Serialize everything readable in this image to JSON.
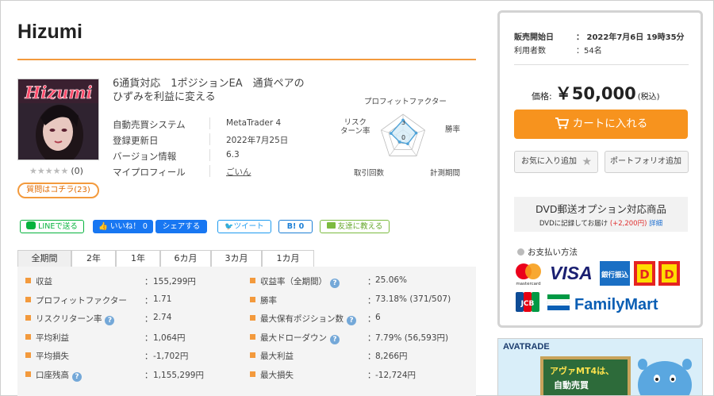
{
  "product": {
    "title": "Hizumi",
    "thumb_text": "Hizumi",
    "rating_stars": "★★★★★",
    "rating_count": "(0)",
    "qa_button": "質問はコチラ(23)",
    "description": "6通貨対応　1ポジションEA　通貨ペアの\nひずみを利益に変える"
  },
  "info": [
    {
      "label": "自動売買システム",
      "value": "MetaTrader 4"
    },
    {
      "label": "登録更新日",
      "value": "2022年7月25日"
    },
    {
      "label": "バージョン情報",
      "value": "6.3"
    },
    {
      "label": "マイプロフィール",
      "value": "ごいん"
    }
  ],
  "radar": {
    "labels": {
      "top": "プロフィットファクター",
      "right_top": "勝率",
      "right_bottom": "計測期間",
      "left_bottom": "取引回数",
      "left_top": "リスク\nターン率"
    },
    "scale_3": "3",
    "scale_0": "0",
    "values": [
      0.75,
      0.6,
      0.35,
      0.25,
      0.55
    ],
    "fill_color": "#d6ecf7",
    "stroke_color": "#4fa3d8"
  },
  "social": {
    "line": "LINEで送る",
    "like": "いいね！ 0",
    "share": "シェアする",
    "tweet": "ツイート",
    "hatena": "B! 0",
    "mail": "友達に教える"
  },
  "tabs": [
    "全期間",
    "2年",
    "1年",
    "6カ月",
    "3カ月",
    "1カ月"
  ],
  "stats_left": [
    {
      "label": "収益",
      "value": "155,299円",
      "help": false
    },
    {
      "label": "プロフィットファクター",
      "value": "1.71",
      "help": false
    },
    {
      "label": "リスクリターン率",
      "value": "2.74",
      "help": true
    },
    {
      "label": "平均利益",
      "value": "1,064円",
      "help": false
    },
    {
      "label": "平均損失",
      "value": "-1,702円",
      "help": false
    },
    {
      "label": "口座残高",
      "value": "1,155,299円",
      "help": true
    }
  ],
  "stats_right": [
    {
      "label": "収益率（全期間）",
      "value": "25.06%",
      "help": true
    },
    {
      "label": "勝率",
      "value": "73.18% (371/507)",
      "help": false
    },
    {
      "label": "最大保有ポジション数",
      "value": "6",
      "help": true
    },
    {
      "label": "最大ドローダウン",
      "value": "7.79% (56,593円)",
      "help": true
    },
    {
      "label": "最大利益",
      "value": "8,266円",
      "help": false
    },
    {
      "label": "最大損失",
      "value": "-12,724円",
      "help": false
    }
  ],
  "colon": "：",
  "help_glyph": "?",
  "sidebar": {
    "sale_start_label": "販売開始日",
    "sale_start_value": "2022年7月6日 19時35分",
    "users_label": "利用者数",
    "users_value": "54名",
    "colon": "：",
    "price_label": "価格:",
    "price_value": "￥50,000",
    "price_tax": "(税込)",
    "cart_button": "カートに入れる",
    "fav_button": "お気に入り追加",
    "portfolio_button": "ポートフォリオ追加",
    "dvd_title": "DVD郵送オプション対応商品",
    "dvd_note": "DVDに記録してお届け",
    "dvd_price": "(+2,200円)",
    "dvd_detail": "詳細",
    "payment_title": "お支払い方法",
    "payment": {
      "mastercard": "mastercard",
      "visa": "VISA",
      "bank": "銀行振込",
      "jcb": "JCB",
      "familymart": "FamilyMart"
    }
  },
  "ad": {
    "brand": "AVATRADE",
    "line1": "アヴァMT4は、",
    "line2": "自動売買"
  },
  "colors": {
    "accent": "#f39a3d",
    "cart": "#f7931e",
    "facebook": "#1877f2",
    "line": "#06b33d",
    "twitter": "#1d9bf0"
  }
}
